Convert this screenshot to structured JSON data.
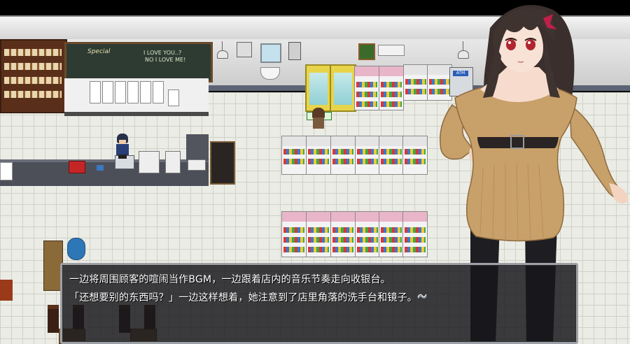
{
  "dialog": {
    "line1": "一边将周围顾客的喧闹当作BGM，一边跟着店内的音乐节奏走向收银台。",
    "line2": "「还想要别的东西吗？」一边这样想着，她注意到了店里角落的洗手台和镜子。"
  },
  "scene": {
    "chalkboard_title": "Special",
    "chalkboard_line1": "I LOVE YOU..?",
    "chalkboard_line2": "NO I LOVE ME!",
    "atm_label": "ATM"
  },
  "icons": {
    "dialog_continue": "wave-cursor-icon",
    "fan": "ventilation-fan-icon",
    "camera": "security-camera-icon"
  },
  "colors": {
    "dialog_bg": "#18181c",
    "dialog_border": "#9da0a6",
    "floor": "#ebece5",
    "sweater": "#c8a06a"
  }
}
